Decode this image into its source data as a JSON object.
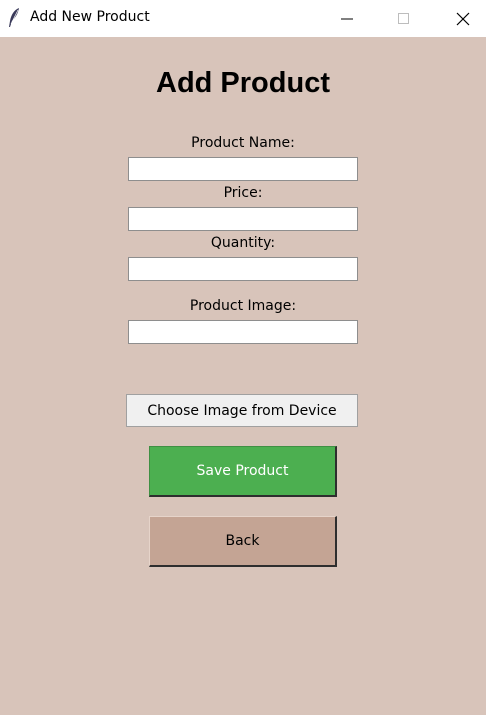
{
  "window": {
    "title": "Add New Product",
    "icons": {
      "app": "feather-icon",
      "minimize": "minimize-icon",
      "maximize": "maximize-icon",
      "close": "close-icon"
    }
  },
  "form": {
    "heading": "Add Product",
    "fields": [
      {
        "label": "Product Name:",
        "value": ""
      },
      {
        "label": "Price:",
        "value": ""
      },
      {
        "label": "Quantity:",
        "value": ""
      },
      {
        "label": "Product Image:",
        "value": ""
      }
    ]
  },
  "buttons": {
    "choose_image": "Choose Image from Device",
    "save": "Save Product",
    "back": "Back"
  },
  "colors": {
    "background": "#d8c4ba",
    "save_button": "#4caf50",
    "back_button": "#c4a494"
  }
}
